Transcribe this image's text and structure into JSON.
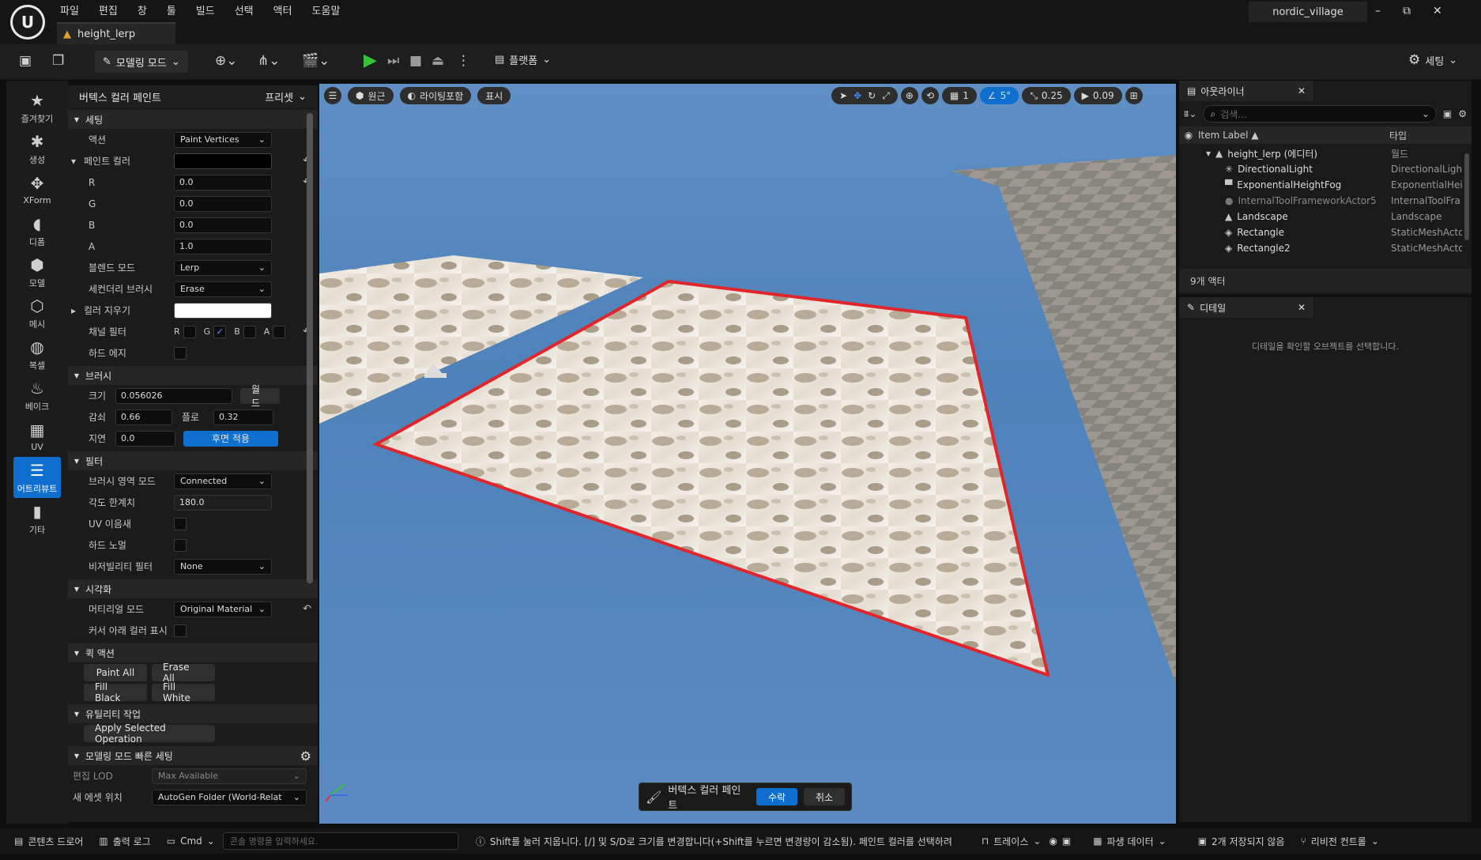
{
  "menu": [
    "파일",
    "편집",
    "창",
    "툴",
    "빌드",
    "선택",
    "액터",
    "도움말"
  ],
  "level_tab": "height_lerp",
  "project_name": "nordic_village",
  "window": {
    "minimize": "–",
    "restore": "⧉",
    "close": "✕"
  },
  "toolbar": {
    "mode_label": "모델링 모드",
    "platform_label": "플랫폼",
    "settings_label": "세팅"
  },
  "modes": [
    {
      "icon": "★",
      "label": "즐겨찾기"
    },
    {
      "icon": "✱",
      "label": "생성"
    },
    {
      "icon": "✥",
      "label": "XForm"
    },
    {
      "icon": "◖",
      "label": "디폼"
    },
    {
      "icon": "⬢",
      "label": "모델"
    },
    {
      "icon": "⬡",
      "label": "메시"
    },
    {
      "icon": "◍",
      "label": "복셀"
    },
    {
      "icon": "♨",
      "label": "베이크"
    },
    {
      "icon": "▦",
      "label": "UV"
    },
    {
      "icon": "☰",
      "label": "어트리뷰트"
    },
    {
      "icon": "▮",
      "label": "기타"
    }
  ],
  "tool_panel": {
    "title": "버텍스 컬러 페인트",
    "preset_label": "프리셋",
    "sections": {
      "settings": "세팅",
      "brush": "브러시",
      "filter": "필터",
      "visualization": "시각화",
      "quick_actions": "퀵 액션",
      "utility": "유틸리티 작업",
      "quick_settings": "모델링 모드 빠른 세팅"
    },
    "action_label": "액션",
    "action_value": "Paint Vertices",
    "paint_color_label": "페인트 컬러",
    "r_label": "R",
    "r_value": "0.0",
    "g_label": "G",
    "g_value": "0.0",
    "b_label": "B",
    "b_value": "0.0",
    "a_label": "A",
    "a_value": "1.0",
    "blend_mode_label": "블렌드 모드",
    "blend_mode_value": "Lerp",
    "secondary_brush_label": "세컨더리 브러시",
    "secondary_brush_value": "Erase",
    "erase_color_label": "컬러 지우기",
    "channel_filter_label": "채널 필터",
    "channel_r": "R",
    "channel_g": "G",
    "channel_b": "B",
    "channel_a": "A",
    "hard_edge_label": "하드 에지",
    "size_label": "크기",
    "size_value": "0.056026",
    "world_button": "월드",
    "falloff_label": "감쇠",
    "falloff_value": "0.66",
    "flow_label": "플로",
    "flow_value": "0.32",
    "delay_label": "지연",
    "delay_value": "0.0",
    "backface_button": "후면 적용",
    "region_mode_label": "브러시 영역 모드",
    "region_mode_value": "Connected",
    "angle_limit_label": "각도 한계치",
    "angle_limit_value": "180.0",
    "uv_seam_label": "UV 이음새",
    "hard_normal_label": "하드 노멀",
    "visibility_filter_label": "비저빌리티 필터",
    "visibility_filter_value": "None",
    "material_mode_label": "머티리얼 모드",
    "material_mode_value": "Original Material",
    "show_color_label": "커서 아래 컬러 표시",
    "paint_all": "Paint All",
    "erase_all": "Erase All",
    "fill_black": "Fill Black",
    "fill_white": "Fill White",
    "apply_selected": "Apply Selected Operation",
    "edit_lod_label": "편집 LOD",
    "edit_lod_value": "Max Available",
    "new_asset_label": "새 에셋 위치",
    "new_asset_value": "AutoGen Folder (World-Relat"
  },
  "viewport": {
    "perspective": "원근",
    "lighting": "라이팅포함",
    "show": "표시",
    "grid_value": "1",
    "angle_value": "5°",
    "scale_value": "0.25",
    "camera_value": "0.09",
    "accept": "수락",
    "cancel": "취소",
    "tool_name": "버텍스 컬러 페인트"
  },
  "outliner": {
    "title": "아웃라이너",
    "search_placeholder": "검색...",
    "col_label": "Item Label ▲",
    "col_type": "타입",
    "rows": [
      {
        "name": "height_lerp (에디터)",
        "type": "월드",
        "icon": "▲"
      },
      {
        "name": "DirectionalLight",
        "type": "DirectionalLigh",
        "icon": "✳"
      },
      {
        "name": "ExponentialHeightFog",
        "type": "ExponentialHei",
        "icon": "▀"
      },
      {
        "name": "InternalToolFrameworkActor5",
        "type": "InternalToolFra",
        "icon": "●"
      },
      {
        "name": "Landscape",
        "type": "Landscape",
        "icon": "▲"
      },
      {
        "name": "Rectangle",
        "type": "StaticMeshActo",
        "icon": "◈"
      },
      {
        "name": "Rectangle2",
        "type": "StaticMeshActo",
        "icon": "◈"
      }
    ],
    "actor_count": "9개 액터"
  },
  "details": {
    "title": "디테일",
    "empty_message": "디테일을 확인할 오브젝트를 선택합니다."
  },
  "statusbar": {
    "content_drawer": "콘텐츠 드로어",
    "output_log": "출력 로그",
    "cmd": "Cmd",
    "cmd_placeholder": "콘솔 명령을 입력하세요.",
    "hint": "Shift를 눌러 지웁니다. [/] 및 S/D로 크기를 변경합니다(+Shift를 누르면 변경량이 감소됨). 페인트 컬러를 선택하려",
    "trace": "트레이스",
    "derived_data": "파생 데이터",
    "unsaved": "2개 저장되지 않음",
    "revision": "리비전 컨트롤"
  },
  "colors": {
    "accent": "#0e6fcf",
    "selection": "#e0262a",
    "sky": "#5a8ac1"
  }
}
